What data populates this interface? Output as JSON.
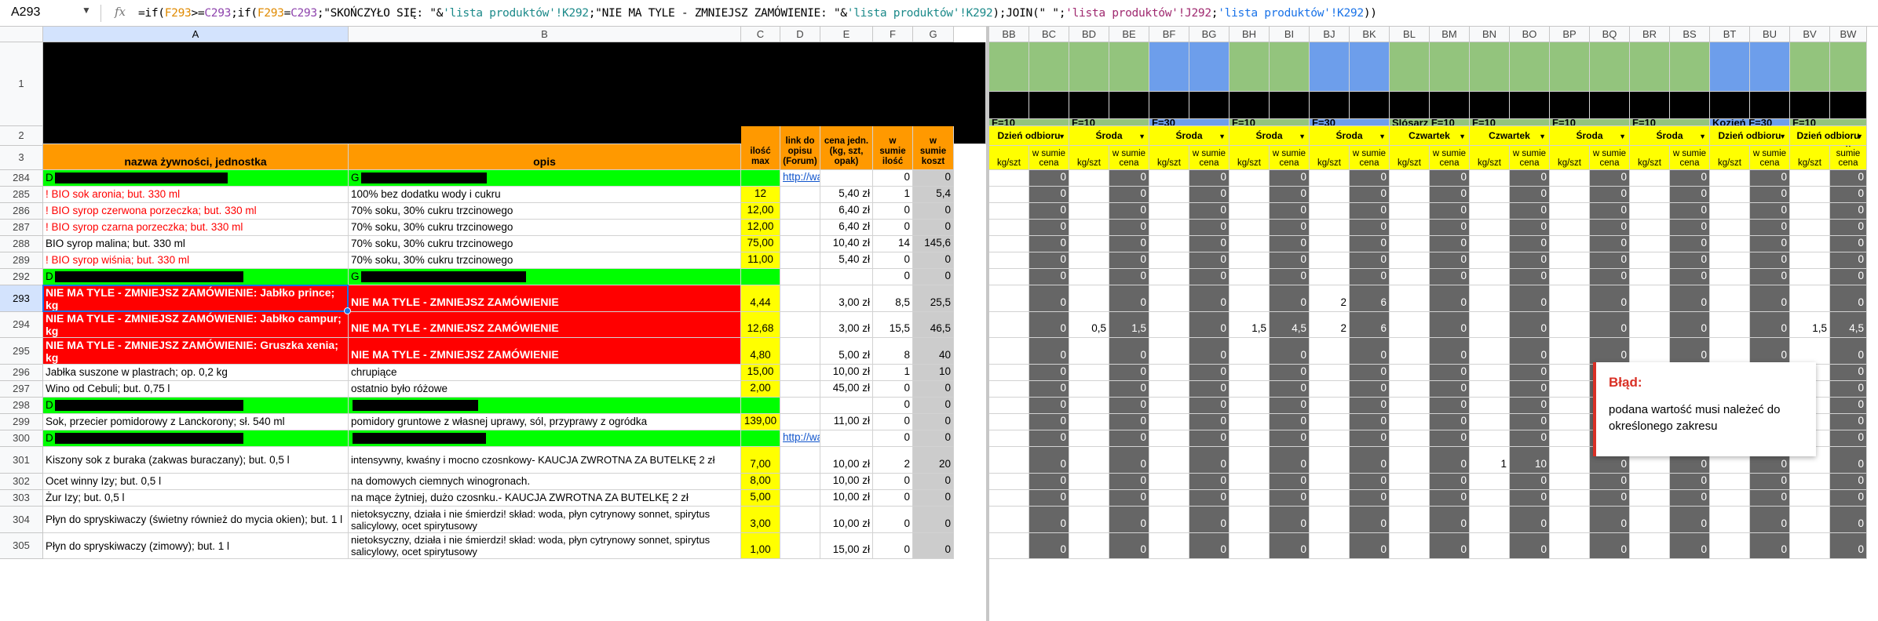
{
  "formula_bar": {
    "name_box": "A293",
    "fx": "fx",
    "formula_parts": [
      {
        "t": "=if(",
        "c": ""
      },
      {
        "t": "F293",
        "c": "fc1"
      },
      {
        "t": ">=",
        "c": ""
      },
      {
        "t": "C293",
        "c": "fc2"
      },
      {
        "t": ";if(",
        "c": ""
      },
      {
        "t": "F293",
        "c": "fc1"
      },
      {
        "t": "=",
        "c": ""
      },
      {
        "t": "C293",
        "c": "fc2"
      },
      {
        "t": ";\"SKOŃCZYŁO SIĘ: \"&",
        "c": ""
      },
      {
        "t": "'lista produktów'!K292",
        "c": "fc3"
      },
      {
        "t": ";\"NIE MA TYLE - ZMNIEJSZ ZAMÓWIENIE: \"&",
        "c": ""
      },
      {
        "t": "'lista produktów'!K292",
        "c": "fc3"
      },
      {
        "t": ");JOIN(\" \";",
        "c": ""
      },
      {
        "t": "'lista produktów'!J292",
        "c": "fc4"
      },
      {
        "t": ";",
        "c": ""
      },
      {
        "t": "'lista produktów'!K292",
        "c": "fc5"
      },
      {
        "t": "))",
        "c": ""
      }
    ]
  },
  "columns_left": [
    "A",
    "B",
    "C",
    "D",
    "E",
    "F",
    "G"
  ],
  "columns_right": [
    "BB",
    "BC",
    "BD",
    "BE",
    "BF",
    "BG",
    "BH",
    "BI",
    "BJ",
    "BK",
    "BL",
    "BM",
    "BN",
    "BO",
    "BP",
    "BQ",
    "BR",
    "BS",
    "BT",
    "BU",
    "BV",
    "BW"
  ],
  "header": {
    "a3": "nazwa żywności, jednostka",
    "b3": "opis",
    "c3": "ilość max",
    "d3": "link do opisu (Forum)",
    "e3": "cena jedn. (kg, szt, opak)",
    "f3": "w sumie ilość",
    "g3": "w sumie koszt",
    "group_labels": [
      "F=10",
      "F=10",
      "F=30",
      "F=10",
      "F=30",
      "Ślósarz F=10",
      "F=10",
      "F=10",
      "F=10",
      "Kozień F=30",
      "F=10"
    ],
    "day_labels": [
      "Dzień odbioru",
      "Środa",
      "Środa",
      "Środa",
      "Środa",
      "Czwartek",
      "Czwartek",
      "Środa",
      "Środa",
      "Dzień odbioru",
      "Dzień odbioru"
    ],
    "sub_labels": [
      "kg/szt",
      "w sumie cena"
    ]
  },
  "rows": [
    {
      "n": "284",
      "a": "D",
      "b": "G",
      "c": "",
      "d": "http://waw",
      "e": "",
      "f": "0",
      "g": "0",
      "type": "green"
    },
    {
      "n": "285",
      "a": "! BIO sok aronia; but. 330 ml",
      "b": "100% bez dodatku wody i cukru",
      "c": "12",
      "d": "",
      "e": "5,40 zł",
      "f": "1",
      "g": "5,4",
      "red_text": true
    },
    {
      "n": "286",
      "a": "! BIO syrop czerwona porzeczka; but. 330 ml",
      "b": "70% soku, 30% cukru trzcinowego",
      "c": "12,00",
      "d": "",
      "e": "6,40 zł",
      "f": "0",
      "g": "0",
      "red_text": true
    },
    {
      "n": "287",
      "a": "! BIO syrop czarna porzeczka; but. 330 ml",
      "b": "70% soku, 30% cukru trzcinowego",
      "c": "12,00",
      "d": "",
      "e": "6,40 zł",
      "f": "0",
      "g": "0",
      "red_text": true
    },
    {
      "n": "288",
      "a": "BIO syrop malina; but. 330 ml",
      "b": "70% soku, 30% cukru trzcinowego",
      "c": "75,00",
      "d": "",
      "e": "10,40 zł",
      "f": "14",
      "g": "145,6"
    },
    {
      "n": "289",
      "a": "! BIO syrop wiśnia; but. 330 ml",
      "b": "70% soku, 30% cukru trzcinowego",
      "c": "11,00",
      "d": "",
      "e": "5,40 zł",
      "f": "0",
      "g": "0",
      "red_text": true
    },
    {
      "n": "292",
      "a": "D",
      "b": "G",
      "c": "",
      "d": "",
      "e": "",
      "f": "0",
      "g": "0",
      "type": "green"
    },
    {
      "n": "293",
      "a": "NIE MA TYLE - ZMNIEJSZ ZAMÓWIENIE: Jabłko prince; kg",
      "b": "NIE MA TYLE - ZMNIEJSZ ZAMÓWIENIE",
      "c": "4,44",
      "d": "",
      "e": "3,00 zł",
      "f": "8,5",
      "g": "25,5",
      "type": "red",
      "vals": {
        "BJ": "2",
        "BK": "6"
      }
    },
    {
      "n": "294",
      "a": "NIE MA TYLE - ZMNIEJSZ ZAMÓWIENIE: Jabłko campur; kg",
      "b": "NIE MA TYLE - ZMNIEJSZ ZAMÓWIENIE",
      "c": "12,68",
      "d": "",
      "e": "3,00 zł",
      "f": "15,5",
      "g": "46,5",
      "type": "red",
      "vals": {
        "BD": "0,5",
        "BE": "1,5",
        "BH": "1,5",
        "BI": "4,5",
        "BJ": "2",
        "BK": "6",
        "BV": "1,5",
        "BW": "4,5"
      }
    },
    {
      "n": "295",
      "a": "NIE MA TYLE - ZMNIEJSZ ZAMÓWIENIE: Gruszka xenia; kg",
      "b": "NIE MA TYLE - ZMNIEJSZ ZAMÓWIENIE",
      "c": "4,80",
      "d": "",
      "e": "5,00 zł",
      "f": "8",
      "g": "40",
      "type": "red"
    },
    {
      "n": "296",
      "a": "Jabłka suszone w plastrach; op. 0,2 kg",
      "b": "chrupiące",
      "c": "15,00",
      "d": "",
      "e": "10,00 zł",
      "f": "1",
      "g": "10"
    },
    {
      "n": "297",
      "a": "Wino od Cebuli; but. 0,75 l",
      "b": "ostatnio było różowe",
      "c": "2,00",
      "d": "",
      "e": "45,00 zł",
      "f": "0",
      "g": "0"
    },
    {
      "n": "298",
      "a": "D",
      "b": "",
      "c": "",
      "d": "",
      "e": "",
      "f": "0",
      "g": "0",
      "type": "green"
    },
    {
      "n": "299",
      "a": "Sok, przecier pomidorowy z Lanckorony; sł. 540 ml",
      "b": "pomidory gruntowe z własnej uprawy, sól, przyprawy z ogródka",
      "c": "139,00",
      "d": "",
      "e": "11,00 zł",
      "f": "0",
      "g": "0"
    },
    {
      "n": "300",
      "a": "D",
      "b": "",
      "c": "",
      "d": "http://waw",
      "e": "",
      "f": "0",
      "g": "0",
      "type": "green"
    },
    {
      "n": "301",
      "a": "Kiszony sok z buraka (zakwas buraczany); but. 0,5 l",
      "b": "intensywny, kwaśny i mocno czosnkowy- KAUCJA ZWROTNA ZA BUTELKĘ 2 zł",
      "c": "7,00",
      "d": "",
      "e": "10,00 zł",
      "f": "2",
      "g": "20",
      "vals": {
        "BN": "1",
        "BO": "10"
      }
    },
    {
      "n": "302",
      "a": "Ocet winny Izy; but. 0,5 l",
      "b": "na domowych ciemnych winogronach.",
      "c": "8,00",
      "d": "",
      "e": "10,00 zł",
      "f": "0",
      "g": "0"
    },
    {
      "n": "303",
      "a": "Żur Izy; but. 0,5 l",
      "b": "na mące żytniej, dużo czosnku.-  KAUCJA ZWROTNA ZA BUTELKĘ 2 zł",
      "c": "5,00",
      "d": "",
      "e": "10,00 zł",
      "f": "0",
      "g": "0"
    },
    {
      "n": "304",
      "a": "Płyn do spryskiwaczy (świetny również do mycia okien); but. 1 l",
      "b": "nietoksyczny, działa i nie śmierdzi! skład: woda, płyn cytrynowy sonnet, spirytus salicylowy, ocet spirytusowy",
      "c": "3,00",
      "d": "",
      "e": "10,00 zł",
      "f": "0",
      "g": "0"
    },
    {
      "n": "305",
      "a": "Płyn do spryskiwaczy (zimowy); but. 1 l",
      "b": "nietoksyczny, działa i nie śmierdzi! skład: woda, płyn cytrynowy sonnet, spirytus salicylowy, ocet spirytusowy",
      "c": "1,00",
      "d": "",
      "e": "15,00 zł",
      "f": "0",
      "g": "0"
    }
  ],
  "error_tip": {
    "title": "Błąd:",
    "message": "podana wartość musi należeć do określonego zakresu"
  },
  "colors": {
    "green": "#00ff00",
    "red_fill": "#ff0000",
    "orange": "#ff9900",
    "yellow": "#ffff00",
    "dark_gray": "#666666",
    "light_gray": "#cccccc",
    "header_green": "#93c47d",
    "header_blue": "#6d9eeb",
    "selection": "#1a73e8"
  }
}
